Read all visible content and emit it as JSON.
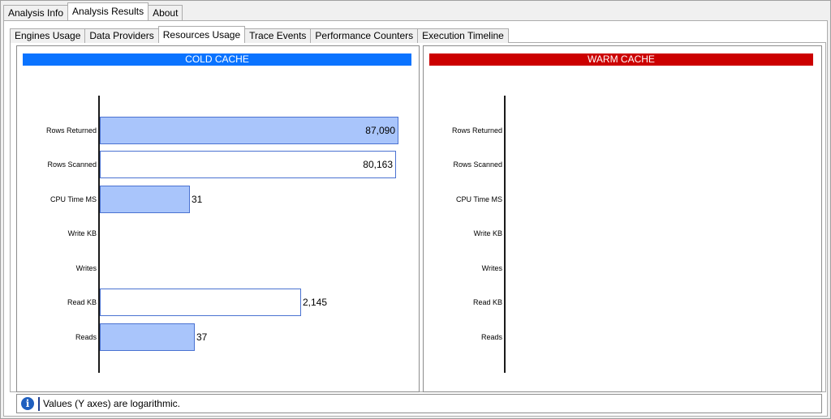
{
  "top_tabs": [
    {
      "label": "Analysis Info",
      "active": false
    },
    {
      "label": "Analysis Results",
      "active": true
    },
    {
      "label": "About",
      "active": false
    }
  ],
  "sub_tabs": [
    {
      "label": "Engines Usage",
      "active": false
    },
    {
      "label": "Data Providers",
      "active": false
    },
    {
      "label": "Resources Usage",
      "active": true
    },
    {
      "label": "Trace Events",
      "active": false
    },
    {
      "label": "Performance Counters",
      "active": false
    },
    {
      "label": "Execution Timeline",
      "active": false
    }
  ],
  "colors": {
    "cold_header": "#0a73ff",
    "warm_header": "#cc0000",
    "bar_fill": "#a9c5fb",
    "bar_border": "#4a72d1",
    "info_icon": "#1f5fbf"
  },
  "chart_data": [
    {
      "type": "bar",
      "orientation": "horizontal",
      "title": "COLD CACHE",
      "log_scale": true,
      "categories": [
        "Rows Returned",
        "Rows Scanned",
        "CPU Time MS",
        "Write KB",
        "Writes",
        "Read KB",
        "Reads"
      ],
      "values": [
        87090,
        80163,
        31,
        null,
        null,
        2145,
        37
      ],
      "value_labels": [
        "87,090",
        "80,163",
        "31",
        "",
        "",
        "2,145",
        "37"
      ]
    },
    {
      "type": "bar",
      "orientation": "horizontal",
      "title": "WARM CACHE",
      "log_scale": true,
      "categories": [
        "Rows Returned",
        "Rows Scanned",
        "CPU Time MS",
        "Write KB",
        "Writes",
        "Read KB",
        "Reads"
      ],
      "values": [
        null,
        null,
        null,
        null,
        null,
        null,
        null
      ],
      "value_labels": [
        "",
        "",
        "",
        "",
        "",
        "",
        ""
      ]
    }
  ],
  "info": {
    "icon": "info-icon",
    "text": "Values (Y axes) are logarithmic."
  }
}
